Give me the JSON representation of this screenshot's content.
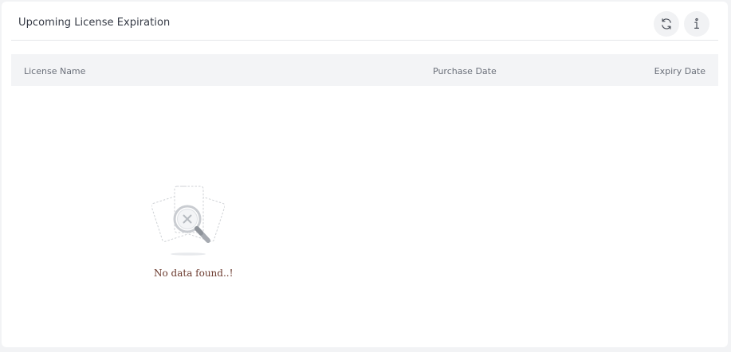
{
  "widget": {
    "title": "Upcoming License Expiration",
    "actions": {
      "refresh_icon": "refresh-icon",
      "info_icon": "info-icon"
    }
  },
  "table": {
    "columns": [
      "License Name",
      "Purchase Date",
      "Expiry Date"
    ],
    "rows": []
  },
  "empty_state": {
    "icon": "no-data-search-icon",
    "message": "No data found..!"
  },
  "colors": {
    "card_bg": "#ffffff",
    "page_bg": "#f2f3f5",
    "header_row_bg": "#f3f4f6",
    "empty_text": "#6b3a2e"
  }
}
